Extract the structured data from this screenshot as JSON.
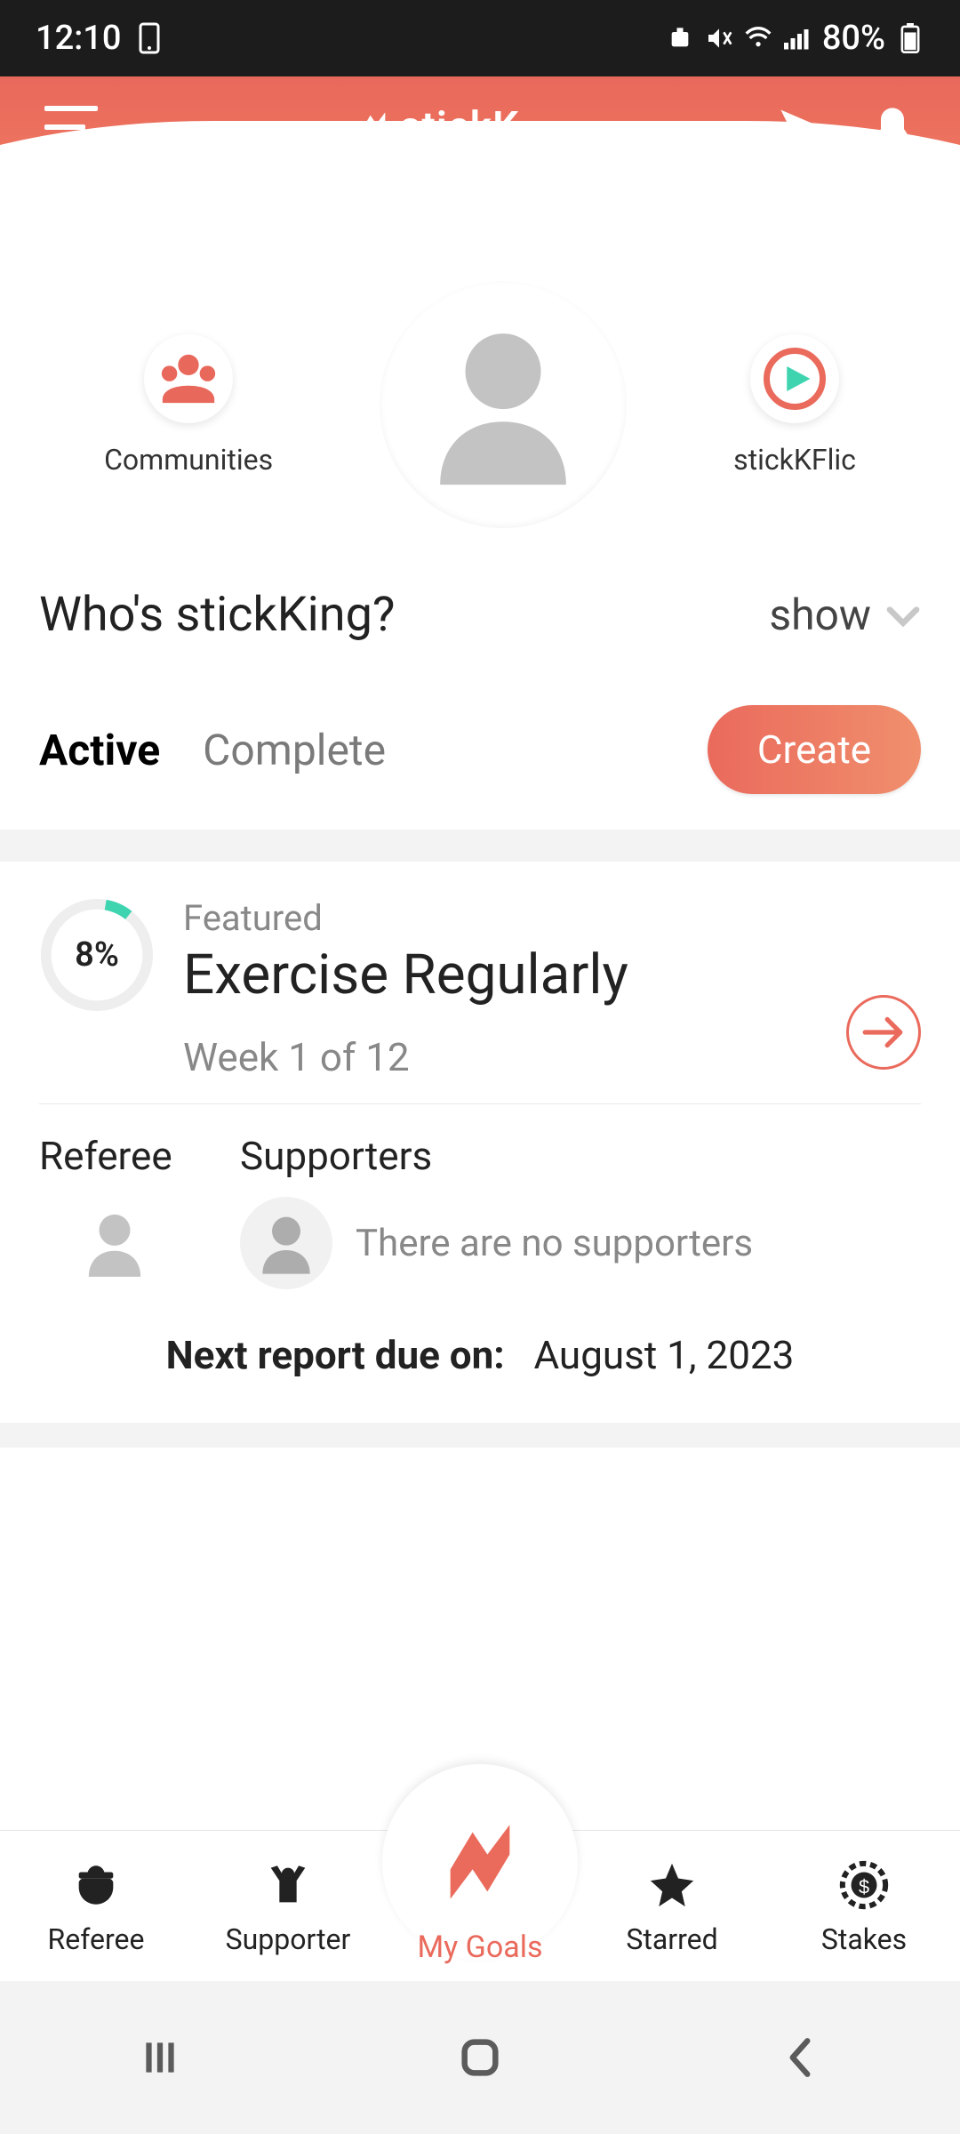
{
  "status": {
    "time": "12:10",
    "battery": "80%"
  },
  "brand": "stickK",
  "circles": {
    "communities_label": "Communities",
    "flic_label": "stickKFlic"
  },
  "question": "Who's stickKing?",
  "show_label": "show",
  "tabs": {
    "active": "Active",
    "complete": "Complete"
  },
  "create_label": "Create",
  "goal": {
    "progress": "8%",
    "featured": "Featured",
    "title": "Exercise Regularly",
    "week": "Week 1 of 12"
  },
  "referee_label": "Referee",
  "supporters_label": "Supporters",
  "no_supporters": "There are no supporters",
  "due_label": "Next report due on:",
  "due_date": "August 1, 2023",
  "nav": {
    "referee": "Referee",
    "supporter": "Supporter",
    "mygoals": "My Goals",
    "starred": "Starred",
    "stakes": "Stakes"
  }
}
